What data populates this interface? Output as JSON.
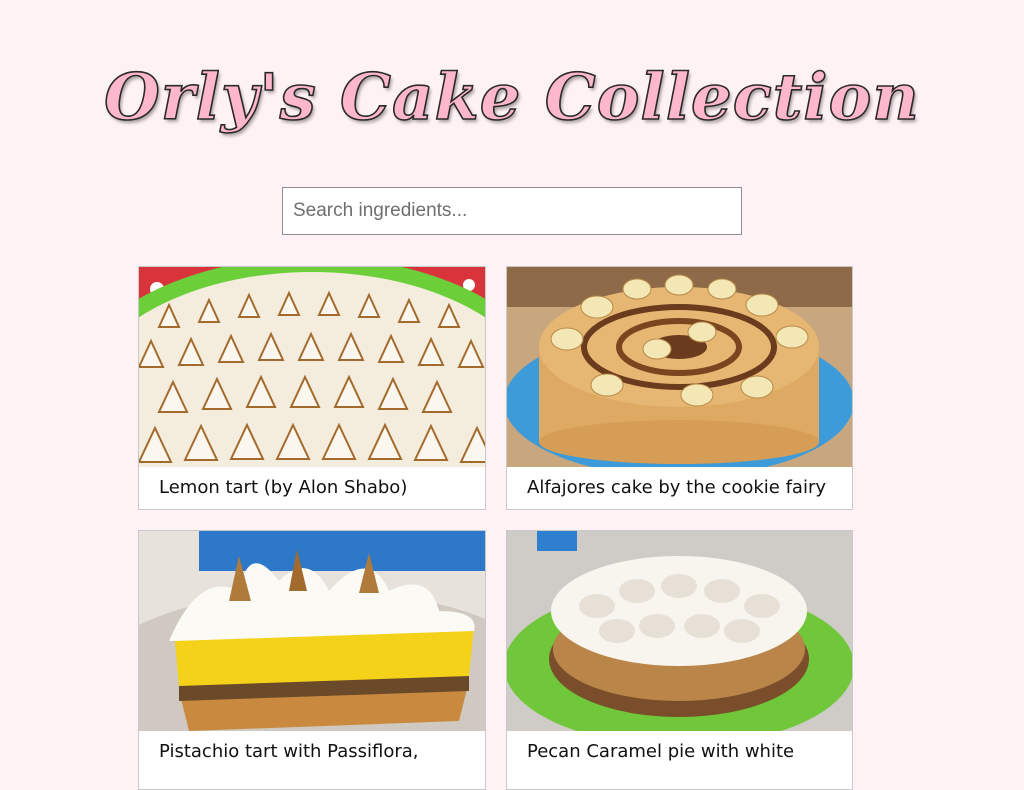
{
  "header": {
    "title": "Orly's Cake Collection"
  },
  "search": {
    "placeholder": "Search ingredients...",
    "value": ""
  },
  "cakes": [
    {
      "caption": "Lemon tart (by Alon Shabo)",
      "image": "meringue-lemon-tart-photo"
    },
    {
      "caption": "Alfajores cake by the cookie fairy",
      "image": "alfajores-cake-photo"
    },
    {
      "caption": "Pistachio tart with Passiflora,",
      "image": "passiflora-meringue-slice-photo"
    },
    {
      "caption": "Pecan Caramel pie with white",
      "image": "pecan-caramel-pie-photo"
    }
  ],
  "colors": {
    "background": "#fff2f5",
    "title_fill": "#ffb8cb",
    "title_outline": "#2a2a2a"
  }
}
